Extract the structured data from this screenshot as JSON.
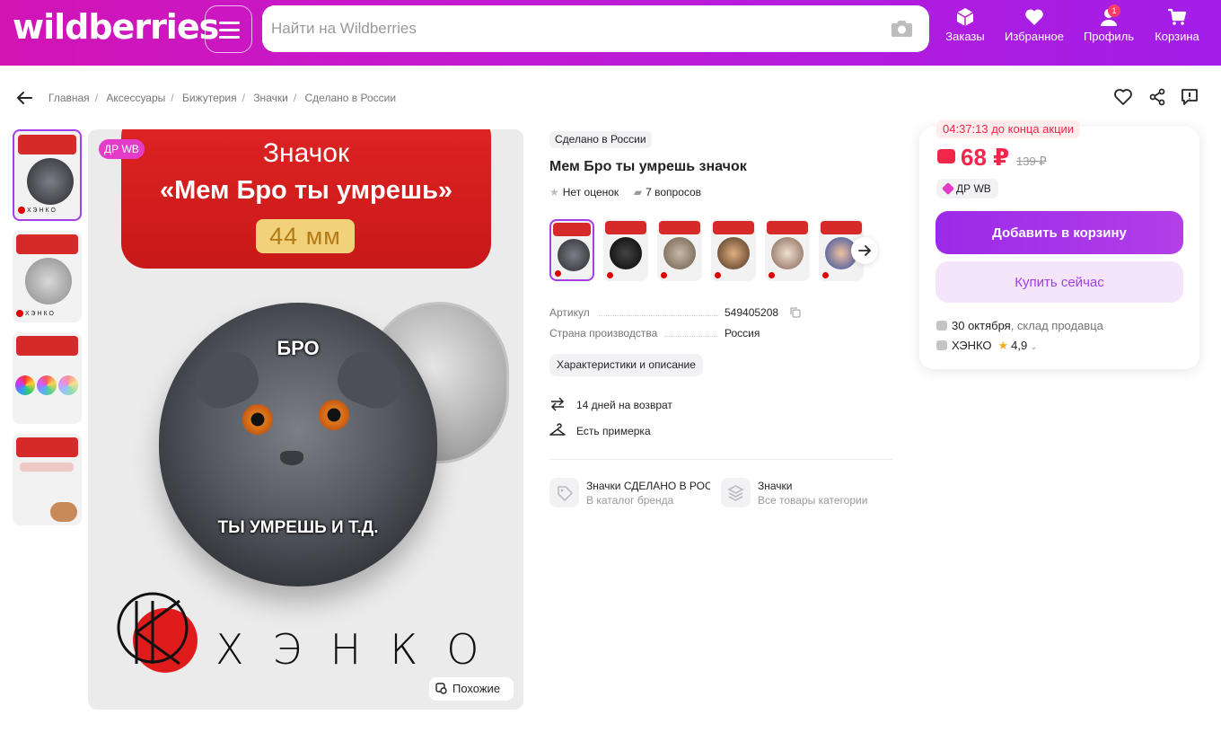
{
  "header": {
    "logo": "wildberries",
    "search_placeholder": "Найти на Wildberries",
    "nav": [
      {
        "label": "Заказы",
        "icon": "box-icon"
      },
      {
        "label": "Избранное",
        "icon": "heart-icon"
      },
      {
        "label": "Профиль",
        "icon": "user-icon",
        "badge": "1"
      },
      {
        "label": "Корзина",
        "icon": "cart-icon"
      }
    ],
    "colors": {
      "gradient_start": "#d214b4",
      "gradient_end": "#a21ee8"
    }
  },
  "breadcrumbs": [
    "Главная",
    "Аксессуары",
    "Бижутерия",
    "Значки",
    "Сделано в России"
  ],
  "gallery": {
    "badge": "ДР WB",
    "main_image": {
      "title_line1": "Значок",
      "title_line2": "«Мем Бро ты умрешь»",
      "size": "44 мм",
      "cat_top_text": "БРО",
      "cat_bottom_text": "ТЫ УМРЕШЬ И Т.Д.",
      "brand": "ХЭНКО"
    },
    "similar_button": "Похожие",
    "thumbs": [
      {
        "title": "Значок «Мем Бро ты умрешь»"
      },
      {
        "title": "Надежное крепление"
      },
      {
        "title": "Цветопередача картинки"
      },
      {
        "title": "Не устроило качество товара?"
      }
    ]
  },
  "product": {
    "tag": "Сделано в России",
    "title": "Мем Бро ты умрешь значок",
    "rating_text": "Нет оценок",
    "questions_text": "7 вопросов",
    "params": [
      {
        "label": "Артикул",
        "value": "549405208"
      },
      {
        "label": "Страна производства",
        "value": "Россия"
      }
    ],
    "characteristics_button": "Характеристики и описание",
    "features": [
      "14 дней на возврат",
      "Есть примерка"
    ],
    "links": [
      {
        "title": "Значки СДЕЛАНО В РОССИИ",
        "subtitle": "В каталог бренда"
      },
      {
        "title": "Значки",
        "subtitle": "Все товары категории"
      }
    ]
  },
  "price_card": {
    "timer": "04:37:13 до конца акции",
    "price": "68 ₽",
    "old_price": "139 ₽",
    "promo_tag": "ДР WB",
    "add_to_cart": "Добавить в корзину",
    "buy_now": "Купить сейчас",
    "delivery_date": "30 октября",
    "delivery_source": ", склад продавца",
    "seller": "ХЭНКО",
    "seller_rating": "4,9",
    "colors": {
      "price": "#f0264a",
      "accent": "#a33ee8"
    }
  }
}
